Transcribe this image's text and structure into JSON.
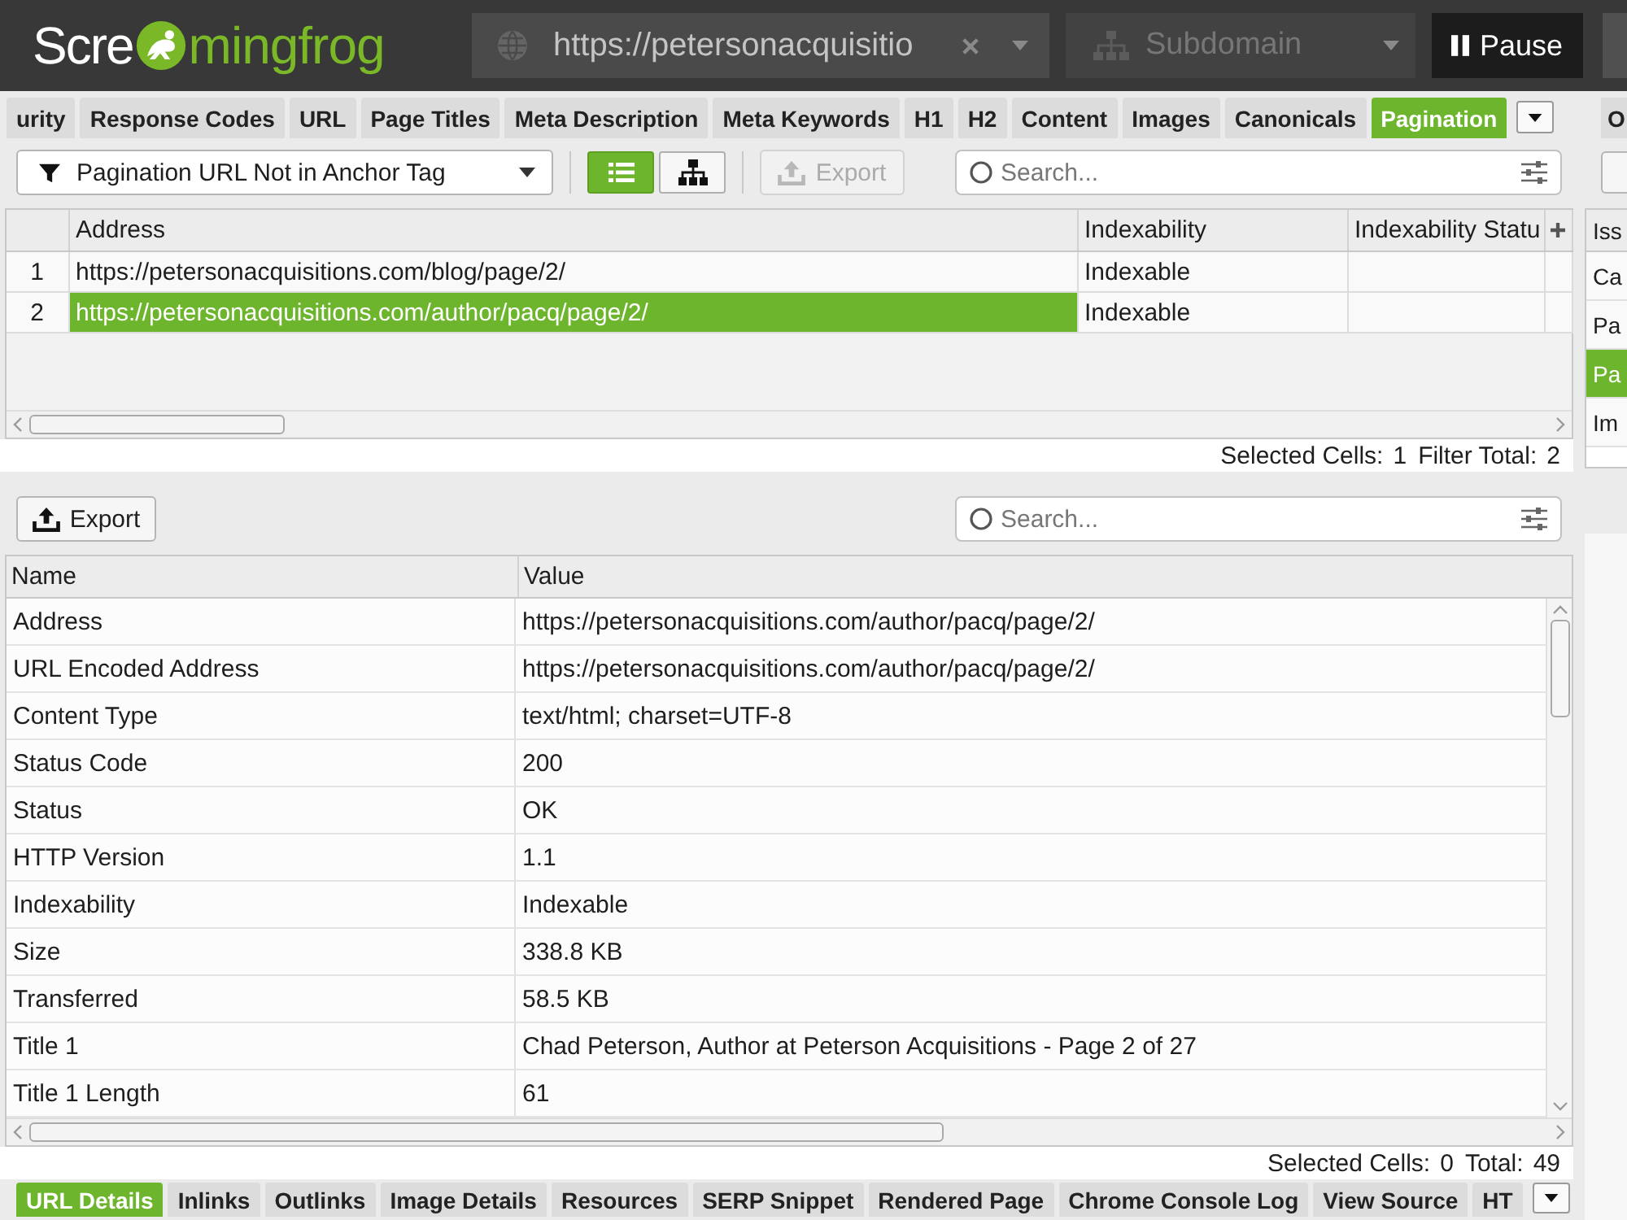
{
  "app_bar": {
    "logo": {
      "text_start": "Scre",
      "text_end": "mingfrog"
    },
    "url_field": {
      "value": "https://petersonacquisitio"
    },
    "crawl_mode": {
      "value": "Subdomain"
    },
    "pause_button": {
      "label": "Pause"
    }
  },
  "tabs": [
    {
      "label": "urity",
      "selected": false
    },
    {
      "label": "Response Codes",
      "selected": false
    },
    {
      "label": "URL",
      "selected": false
    },
    {
      "label": "Page Titles",
      "selected": false
    },
    {
      "label": "Meta Description",
      "selected": false
    },
    {
      "label": "Meta Keywords",
      "selected": false
    },
    {
      "label": "H1",
      "selected": false
    },
    {
      "label": "H2",
      "selected": false
    },
    {
      "label": "Content",
      "selected": false
    },
    {
      "label": "Images",
      "selected": false
    },
    {
      "label": "Canonicals",
      "selected": false
    },
    {
      "label": "Pagination",
      "selected": true
    }
  ],
  "toolbar": {
    "filter": {
      "value": "Pagination URL Not in Anchor Tag"
    },
    "view_buttons": [
      {
        "kind": "list",
        "selected": true
      },
      {
        "kind": "tree",
        "selected": false
      }
    ],
    "export_button": {
      "label": "Export",
      "disabled": true
    },
    "search": {
      "placeholder": "Search..."
    }
  },
  "table": {
    "columns": [
      "Address",
      "Indexability",
      "Indexability Statu"
    ],
    "rows": [
      {
        "number": "1",
        "cells": [
          {
            "text": "https://petersonacquisitions.com/blog/page/2/",
            "selected": false
          },
          {
            "text": "Indexable",
            "selected": false
          }
        ]
      },
      {
        "number": "2",
        "cells": [
          {
            "text": "https://petersonacquisitions.com/author/pacq/page/2/",
            "selected": true
          },
          {
            "text": "Indexable",
            "selected": false
          }
        ]
      }
    ],
    "status": [
      {
        "label": "Selected Cells:",
        "value": "1"
      },
      {
        "label": "Filter Total:",
        "value": "2"
      }
    ]
  },
  "right_panel": {
    "tab": "O",
    "list": {
      "header": "Iss",
      "items": [
        {
          "label": "Ca",
          "selected": false
        },
        {
          "label": "Pa",
          "selected": false
        },
        {
          "label": "Pa",
          "selected": true
        },
        {
          "label": "Im",
          "selected": false
        }
      ]
    }
  },
  "details": {
    "export_button": {
      "label": "Export",
      "disabled": false
    },
    "search": {
      "placeholder": "Search..."
    },
    "columns": [
      "Name",
      "Value"
    ],
    "rows": [
      {
        "name": "Address",
        "value": "https://petersonacquisitions.com/author/pacq/page/2/"
      },
      {
        "name": "URL Encoded Address",
        "value": "https://petersonacquisitions.com/author/pacq/page/2/"
      },
      {
        "name": "Content Type",
        "value": "text/html; charset=UTF-8"
      },
      {
        "name": "Status Code",
        "value": "200"
      },
      {
        "name": "Status",
        "value": "OK"
      },
      {
        "name": "HTTP Version",
        "value": "1.1"
      },
      {
        "name": "Indexability",
        "value": "Indexable"
      },
      {
        "name": "Size",
        "value": "338.8 KB"
      },
      {
        "name": "Transferred",
        "value": "58.5 KB"
      },
      {
        "name": "Title 1",
        "value": "Chad Peterson, Author at Peterson Acquisitions - Page 2 of 27"
      },
      {
        "name": "Title 1 Length",
        "value": "61"
      }
    ],
    "status": [
      {
        "label": "Selected Cells:",
        "value": "0"
      },
      {
        "label": "Total:",
        "value": "49"
      }
    ]
  },
  "bottom_tabs": [
    {
      "label": "URL Details",
      "selected": true
    },
    {
      "label": "Inlinks",
      "selected": false
    },
    {
      "label": "Outlinks",
      "selected": false
    },
    {
      "label": "Image Details",
      "selected": false
    },
    {
      "label": "Resources",
      "selected": false
    },
    {
      "label": "SERP Snippet",
      "selected": false
    },
    {
      "label": "Rendered Page",
      "selected": false
    },
    {
      "label": "Chrome Console Log",
      "selected": false
    },
    {
      "label": "View Source",
      "selected": false
    },
    {
      "label": "HT",
      "selected": false
    }
  ]
}
